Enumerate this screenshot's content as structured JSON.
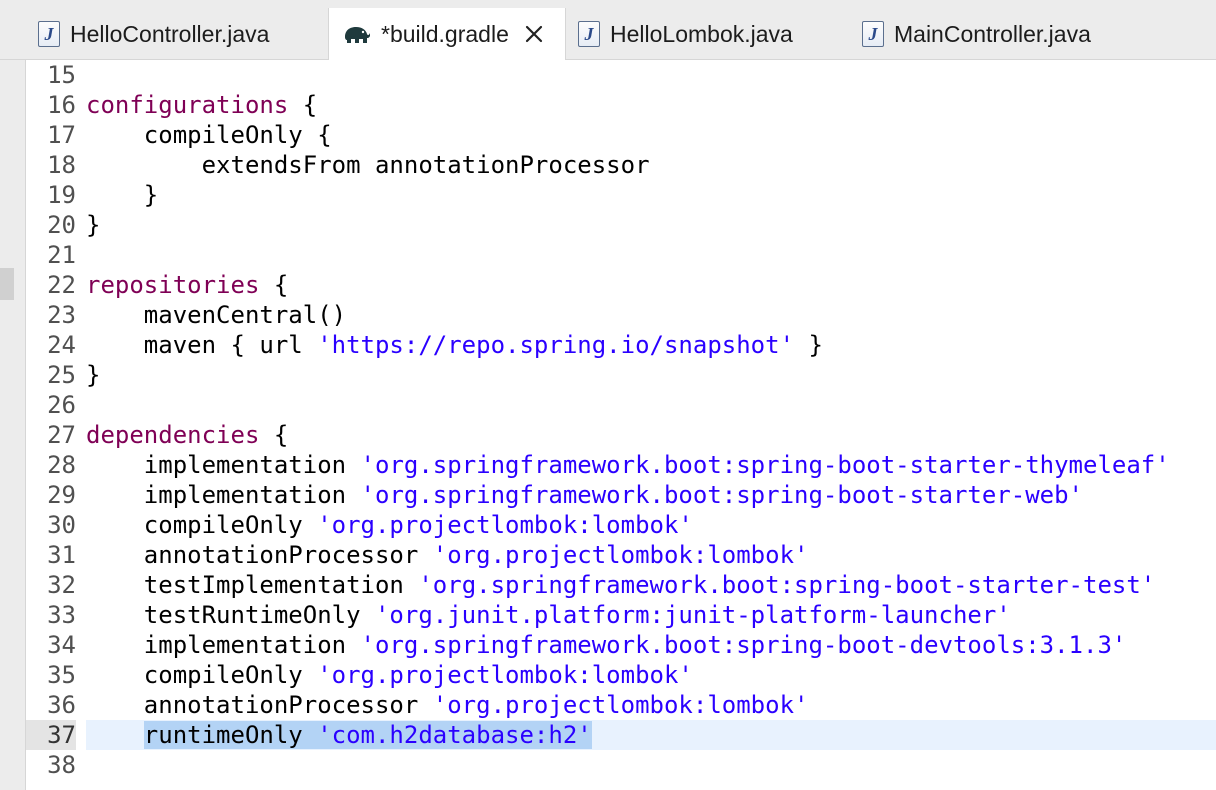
{
  "tabs": [
    {
      "label": "HelloController.java",
      "icon": "java-file-icon",
      "active": false
    },
    {
      "label": "*build.gradle",
      "icon": "gradle-elephant-icon",
      "active": true
    },
    {
      "label": "HelloLombok.java",
      "icon": "java-file-icon",
      "active": false
    },
    {
      "label": "MainController.java",
      "icon": "java-file-icon",
      "active": false
    }
  ],
  "colors": {
    "keyword": "#7f0055",
    "string": "#2a00ff",
    "current_line": "#e8f2fe",
    "selection": "#b3d3f5"
  },
  "editor": {
    "current_line": "37",
    "lines": [
      {
        "num": "15",
        "tokens": []
      },
      {
        "num": "16",
        "tokens": [
          {
            "t": "configurations",
            "k": "kw"
          },
          {
            "t": " {"
          }
        ]
      },
      {
        "num": "17",
        "tokens": [
          {
            "t": "    compileOnly {"
          }
        ]
      },
      {
        "num": "18",
        "tokens": [
          {
            "t": "        extendsFrom annotationProcessor"
          }
        ]
      },
      {
        "num": "19",
        "tokens": [
          {
            "t": "    }"
          }
        ]
      },
      {
        "num": "20",
        "tokens": [
          {
            "t": "}"
          }
        ]
      },
      {
        "num": "21",
        "tokens": []
      },
      {
        "num": "22",
        "tokens": [
          {
            "t": "repositories",
            "k": "kw"
          },
          {
            "t": " {"
          }
        ]
      },
      {
        "num": "23",
        "tokens": [
          {
            "t": "    mavenCentral()"
          }
        ]
      },
      {
        "num": "24",
        "tokens": [
          {
            "t": "    maven { url "
          },
          {
            "t": "'https://repo.spring.io/snapshot'",
            "k": "str"
          },
          {
            "t": " }"
          }
        ]
      },
      {
        "num": "25",
        "tokens": [
          {
            "t": "}"
          }
        ]
      },
      {
        "num": "26",
        "tokens": []
      },
      {
        "num": "27",
        "tokens": [
          {
            "t": "dependencies",
            "k": "kw"
          },
          {
            "t": " {"
          }
        ]
      },
      {
        "num": "28",
        "tokens": [
          {
            "t": "    implementation "
          },
          {
            "t": "'org.springframework.boot:spring-boot-starter-thymeleaf'",
            "k": "str"
          }
        ]
      },
      {
        "num": "29",
        "tokens": [
          {
            "t": "    implementation "
          },
          {
            "t": "'org.springframework.boot:spring-boot-starter-web'",
            "k": "str"
          }
        ]
      },
      {
        "num": "30",
        "tokens": [
          {
            "t": "    compileOnly "
          },
          {
            "t": "'org.projectlombok:lombok'",
            "k": "str"
          }
        ]
      },
      {
        "num": "31",
        "tokens": [
          {
            "t": "    annotationProcessor "
          },
          {
            "t": "'org.projectlombok:lombok'",
            "k": "str"
          }
        ]
      },
      {
        "num": "32",
        "tokens": [
          {
            "t": "    testImplementation "
          },
          {
            "t": "'org.springframework.boot:spring-boot-starter-test'",
            "k": "str"
          }
        ]
      },
      {
        "num": "33",
        "tokens": [
          {
            "t": "    testRuntimeOnly "
          },
          {
            "t": "'org.junit.platform:junit-platform-launcher'",
            "k": "str"
          }
        ]
      },
      {
        "num": "34",
        "tokens": [
          {
            "t": "    implementation "
          },
          {
            "t": "'org.springframework.boot:spring-boot-devtools:3.1.3'",
            "k": "str"
          }
        ]
      },
      {
        "num": "35",
        "tokens": [
          {
            "t": "    compileOnly "
          },
          {
            "t": "'org.projectlombok:lombok'",
            "k": "str"
          }
        ]
      },
      {
        "num": "36",
        "tokens": [
          {
            "t": "    annotationProcessor "
          },
          {
            "t": "'org.projectlombok:lombok'",
            "k": "str"
          }
        ]
      },
      {
        "num": "37",
        "tokens": [
          {
            "t": "    "
          },
          {
            "t": "runtimeOnly ",
            "sel": true
          },
          {
            "t": "'com.h2database:h2'",
            "k": "str",
            "sel": true
          }
        ]
      },
      {
        "num": "38",
        "tokens": []
      }
    ]
  }
}
